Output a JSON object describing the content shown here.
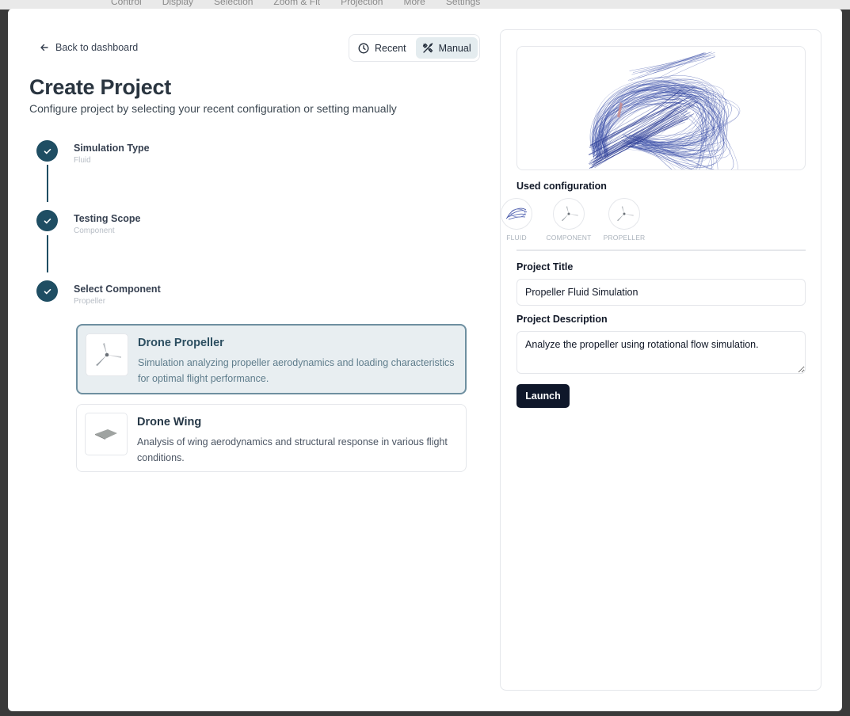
{
  "background_toolbar": {
    "items": [
      "Control",
      "Display",
      "Selection",
      "Zoom & Fit",
      "Projection",
      "More",
      "Settings"
    ]
  },
  "header": {
    "back_label": "Back to dashboard",
    "mode_toggle": {
      "recent_label": "Recent",
      "manual_label": "Manual",
      "active": "Manual"
    }
  },
  "page": {
    "title": "Create Project",
    "subtitle": "Configure project by selecting your recent configuration or setting manually"
  },
  "steps": [
    {
      "title": "Simulation Type",
      "value": "Fluid",
      "completed": true
    },
    {
      "title": "Testing Scope",
      "value": "Component",
      "completed": true
    },
    {
      "title": "Select Component",
      "value": "Propeller",
      "completed": true
    }
  ],
  "components": [
    {
      "name": "Drone Propeller",
      "description": "Simulation analyzing propeller aerodynamics and loading characteristics for optimal flight performance.",
      "selected": true,
      "icon": "propeller-icon"
    },
    {
      "name": "Drone Wing",
      "description": "Analysis of wing aerodynamics and structural response in various flight conditions.",
      "selected": false,
      "icon": "wing-icon"
    }
  ],
  "config_panel": {
    "used_config_title": "Used configuration",
    "chips": [
      {
        "label": "FLUID",
        "icon": "fluid-flow-icon"
      },
      {
        "label": "COMPONENT",
        "icon": "propeller-icon"
      },
      {
        "label": "PROPELLER",
        "icon": "propeller-icon"
      }
    ],
    "project_title_label": "Project Title",
    "project_title_value": "Propeller Fluid Simulation",
    "project_description_label": "Project Description",
    "project_description_value": "Analyze the propeller using rotational flow simulation.",
    "launch_label": "Launch"
  },
  "colors": {
    "accent": "#1f4e63",
    "selected_card_bg": "#e8eef1",
    "selected_card_border": "#6e8fa0",
    "launch_bg": "#0f172a",
    "flow_lines": "#3b4fa8"
  }
}
